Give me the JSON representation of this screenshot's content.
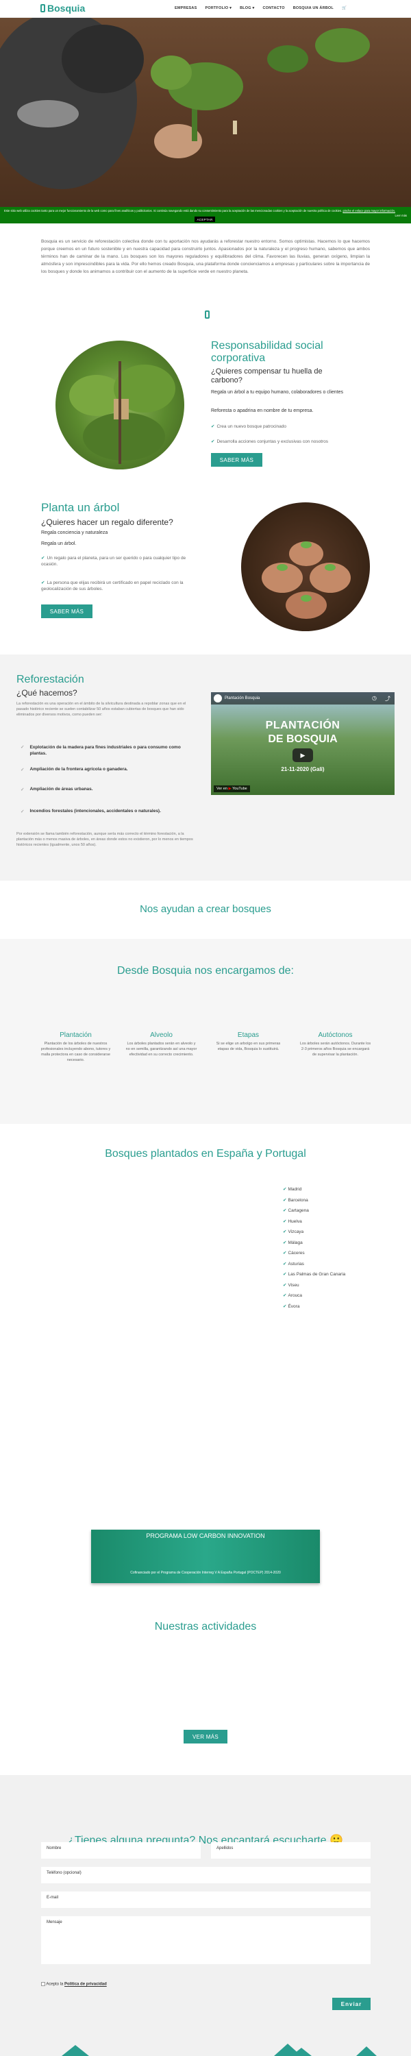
{
  "brand": {
    "name": "Bosquia",
    "accent": "#2a9d8f",
    "cookie_bar_color": "#0a7a0a"
  },
  "nav": {
    "items": [
      "EMPRESAS",
      "PORTFOLIO",
      "BLOG",
      "CONTACTO",
      "BOSQUIA UN ÁRBOL"
    ]
  },
  "cookie": {
    "text": "Este sitio web utiliza cookies tanto para un mejor funcionamiento de la web como para fines analíticos y publicitarios. Si continúa navegando está dando su consentimiento para la aceptación de las mencionadas cookies y la aceptación de nuestra política de cookies.",
    "link": "pinche el enlace para mayor información.",
    "accept": "ACEPTAR",
    "more": "Leer más"
  },
  "intro": {
    "text": "Bosquia es un servicio de reforestación colectiva donde con tu aportación nos ayudarás a reforestar nuestro entorno. Somos optimistas. Hacemos lo que hacemos porque creemos en un futuro sostenible y en nuestra capacidad para construirlo juntos. Apasionados por la naturaleza y el progreso humano, sabemos que ambos términos han de caminar de la mano. Los bosques son los mayores reguladores y equilibradores del clima. Favorecen las lluvias, generan oxígeno, limpian la atmósfera y son imprescindibles para la vida. Por ello hemos creado Bosquia, una plataforma donde concienciamos a empresas y particulares sobre la importancia de los bosques y donde los animamos a contribuir con el aumento de la superficie verde en nuestro planeta."
  },
  "rsc": {
    "title": "Responsabilidad social corporativa",
    "subtitle": "¿Quieres compensar tu huella de carbono?",
    "line1": "Regala un árbol a tu equipo humano, colaboradores o clientes",
    "line2": "Reforesta o apadrina en nombre de tu empresa.",
    "check1": "Crea un nuevo bosque patrocinado",
    "check2": "Desarrolla acciones conjuntas y exclusivas con nosotros",
    "button": "SABER MÁS"
  },
  "planta": {
    "title": "Planta un árbol",
    "subtitle": "¿Quieres hacer un regalo diferente?",
    "line1": "Regala conciencia y naturaleza",
    "line2": "Regala un árbol.",
    "check1": "Un regalo para el planeta, para un ser querido o para cualquier tipo de ocasión.",
    "check2": "La persona que elijas recibirá un certificado en papel reciclado con la geolocalización de sus árboles.",
    "button": "SABER MÁS"
  },
  "refo": {
    "title": "Reforestación",
    "subtitle": "¿Qué hacemos?",
    "text": "La reforestación es una operación en el ámbito de la silvicultura destinada a repoblar zonas que en el pasado histórico reciente se suelen contabilizar 50 años estaban cubiertas de bosques que han sido eliminados por diversos motivos, como pueden ser:",
    "items": [
      "Explotación de la madera para fines industriales o para consumo como plantas.",
      "Ampliación de la frontera agrícola o ganadera.",
      "Ampliación de áreas urbanas.",
      "Incendios forestales (intencionales, accidentales o naturales)."
    ],
    "footer": "Por extensión se llama también reforestación, aunque sería más correcto el término forestación, a la plantación más o menos masiva de árboles, en áreas donde estos no existieron, por lo menos en tiempos históricos recientes (igualmente, unos 50 años).",
    "video": {
      "title": "Plantación Bosquia",
      "overlay1": "PLANTACIÓN",
      "overlay2": "DE BOSQUIA",
      "date": "21-11-2020 (Gali)",
      "watch": "Ver en",
      "yt": "YouTube"
    }
  },
  "sponsors": {
    "title": "Nos ayudan a crear bosques"
  },
  "care": {
    "title": "Desde Bosquia nos encargamos de:",
    "cols": [
      {
        "title": "Plantación",
        "text": "Plantación de los árboles de nuestros profesionales incluyendo abono, tutores y malla protectora en caso de considerarse necesario."
      },
      {
        "title": "Alveolo",
        "text": "Los árboles plantados serán en alveolo y no en semilla, garantizando así una mayor efectividad en su correcto crecimiento."
      },
      {
        "title": "Etapas",
        "text": "Si se elige un arbolgo en sus primeras etapas de vida, Bosquia lo sustituirá."
      },
      {
        "title": "Autóctonos",
        "text": "Los árboles serán autóctonos. Durante los 2-3 primeros años Bosquia se encargará de supervisar la plantación."
      }
    ]
  },
  "plantados": {
    "title": "Bosques plantados en España y Portugal",
    "cities": [
      "Madrid",
      "Barcelona",
      "Cartagena",
      "Huelva",
      "Vizcaya",
      "Málaga",
      "Cáceres",
      "Asturias",
      "Las Palmas de Gran Canaria",
      "Viseu",
      "Arouca",
      "Évora"
    ]
  },
  "program": {
    "title": "PROGRAMA LOW CARBON INNOVATION",
    "sub": "Cofinanciado por el Programa de Cooperación Interreg V A España Portugal (POCTEP) 2014-2020"
  },
  "activities": {
    "title": "Nuestras actividades",
    "button": "VER MÁS"
  },
  "contact": {
    "title": "¿Tienes alguna pregunta? Nos encantará escucharte 🙂",
    "nombre": "Nombre",
    "apellidos": "Apellidos",
    "telefono": "Teléfono (opcional)",
    "email": "E-mail",
    "mensaje": "Mensaje",
    "accept": "Acepto la",
    "privacy": "Política de privacidad",
    "send": "Enviar"
  }
}
